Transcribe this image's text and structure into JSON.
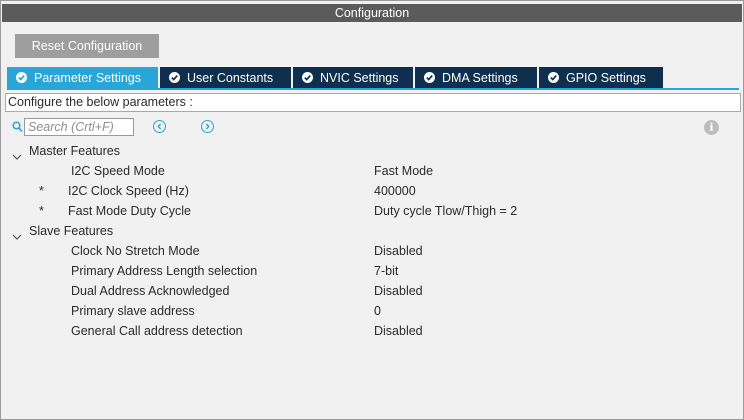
{
  "window": {
    "title": "Configuration"
  },
  "toolbar": {
    "reset_label": "Reset Configuration"
  },
  "tabs": [
    {
      "label": "Parameter Settings",
      "active": true
    },
    {
      "label": "User Constants",
      "active": false
    },
    {
      "label": "NVIC Settings",
      "active": false
    },
    {
      "label": "DMA Settings",
      "active": false
    },
    {
      "label": "GPIO Settings",
      "active": false
    }
  ],
  "description": "Configure the below parameters :",
  "search": {
    "placeholder": "Search (Crtl+F)",
    "value": ""
  },
  "icons": {
    "search": "search-icon",
    "prev": "arrow-left-circle-icon",
    "next": "arrow-right-circle-icon",
    "info": "info-icon",
    "tab_check": "check-circle-icon",
    "group": "chevron-down-icon"
  },
  "colors": {
    "titlebar": "#5b5b5b",
    "active_tab": "#2aa5d8",
    "tab": "#0f2f4f",
    "button": "#9e9e9e"
  },
  "groups": {
    "master": {
      "label": "Master Features",
      "params": [
        {
          "star": "",
          "name": "I2C Speed Mode",
          "value": "Fast Mode"
        },
        {
          "star": "*",
          "name": "I2C Clock Speed (Hz)",
          "value": "400000"
        },
        {
          "star": "*",
          "name": "Fast Mode Duty Cycle",
          "value": "Duty cycle Tlow/Thigh = 2"
        }
      ]
    },
    "slave": {
      "label": "Slave Features",
      "params": [
        {
          "star": "",
          "name": "Clock No Stretch Mode",
          "value": "Disabled"
        },
        {
          "star": "",
          "name": "Primary Address Length selection",
          "value": "7-bit"
        },
        {
          "star": "",
          "name": "Dual Address Acknowledged",
          "value": "Disabled"
        },
        {
          "star": "",
          "name": "Primary slave address",
          "value": "0"
        },
        {
          "star": "",
          "name": "General Call address detection",
          "value": "Disabled"
        }
      ]
    }
  }
}
